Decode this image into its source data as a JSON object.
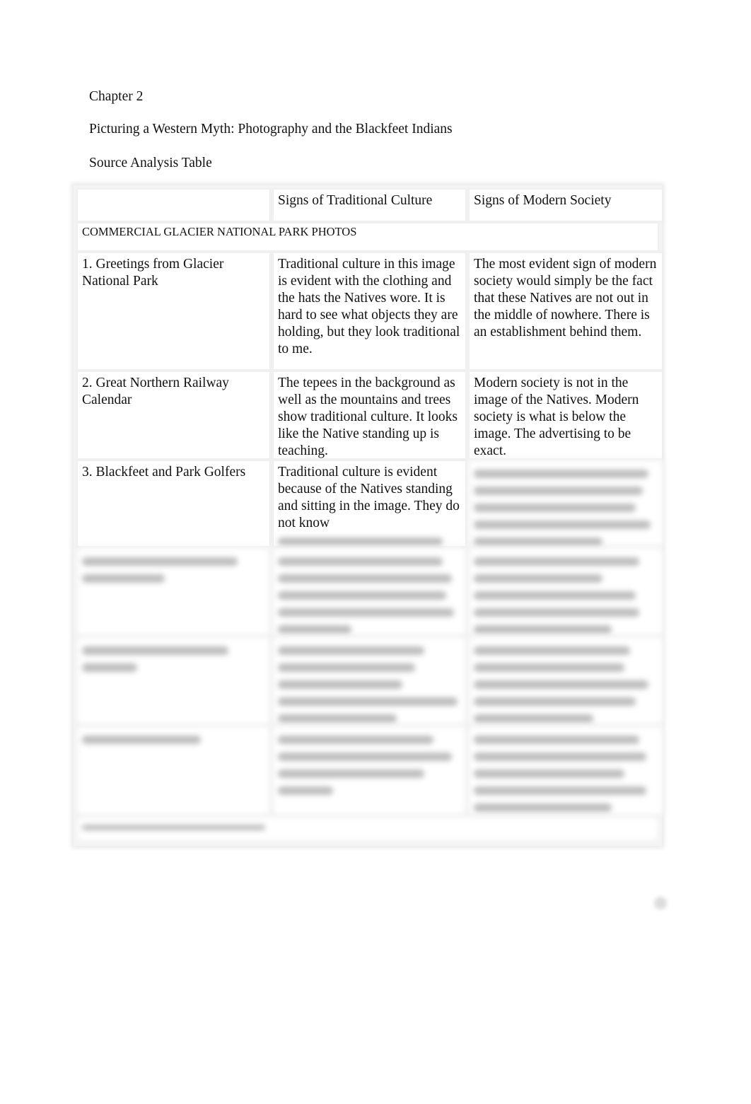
{
  "document": {
    "chapter": "Chapter 2",
    "title": "Picturing a Western Myth: Photography and the Blackfeet Indians",
    "subtitle": "Source Analysis Table"
  },
  "table": {
    "headers": [
      "",
      "Signs of Traditional Culture",
      "Signs of Modern Society"
    ],
    "section_label": "COMMERCIAL GLACIER NATIONAL PARK PHOTOS",
    "rows": [
      {
        "source": "1. Greetings from Glacier National Park",
        "traditional": "Traditional culture in this image is evident with the clothing and the hats the Natives wore. It is hard to see what objects they are holding, but they look traditional to me.",
        "modern": "The most evident sign of modern society would simply be the fact that these Natives are not out in the middle of nowhere. There is an establishment behind them."
      },
      {
        "source": "2. Great Northern Railway Calendar",
        "traditional": "The tepees in the background as well as the mountains and trees show traditional culture. It looks like the Native standing up is teaching.",
        "modern": "Modern society is not in the image of the Natives. Modern society is what is below the image. The advertising to be exact."
      },
      {
        "source": "3. Blackfeet and Park Golfers",
        "traditional": "Traditional culture is evident because of the Natives standing and sitting in the image. They do not know",
        "modern": ""
      }
    ],
    "blurred_rows_count": 3,
    "blurred_footer": true
  }
}
